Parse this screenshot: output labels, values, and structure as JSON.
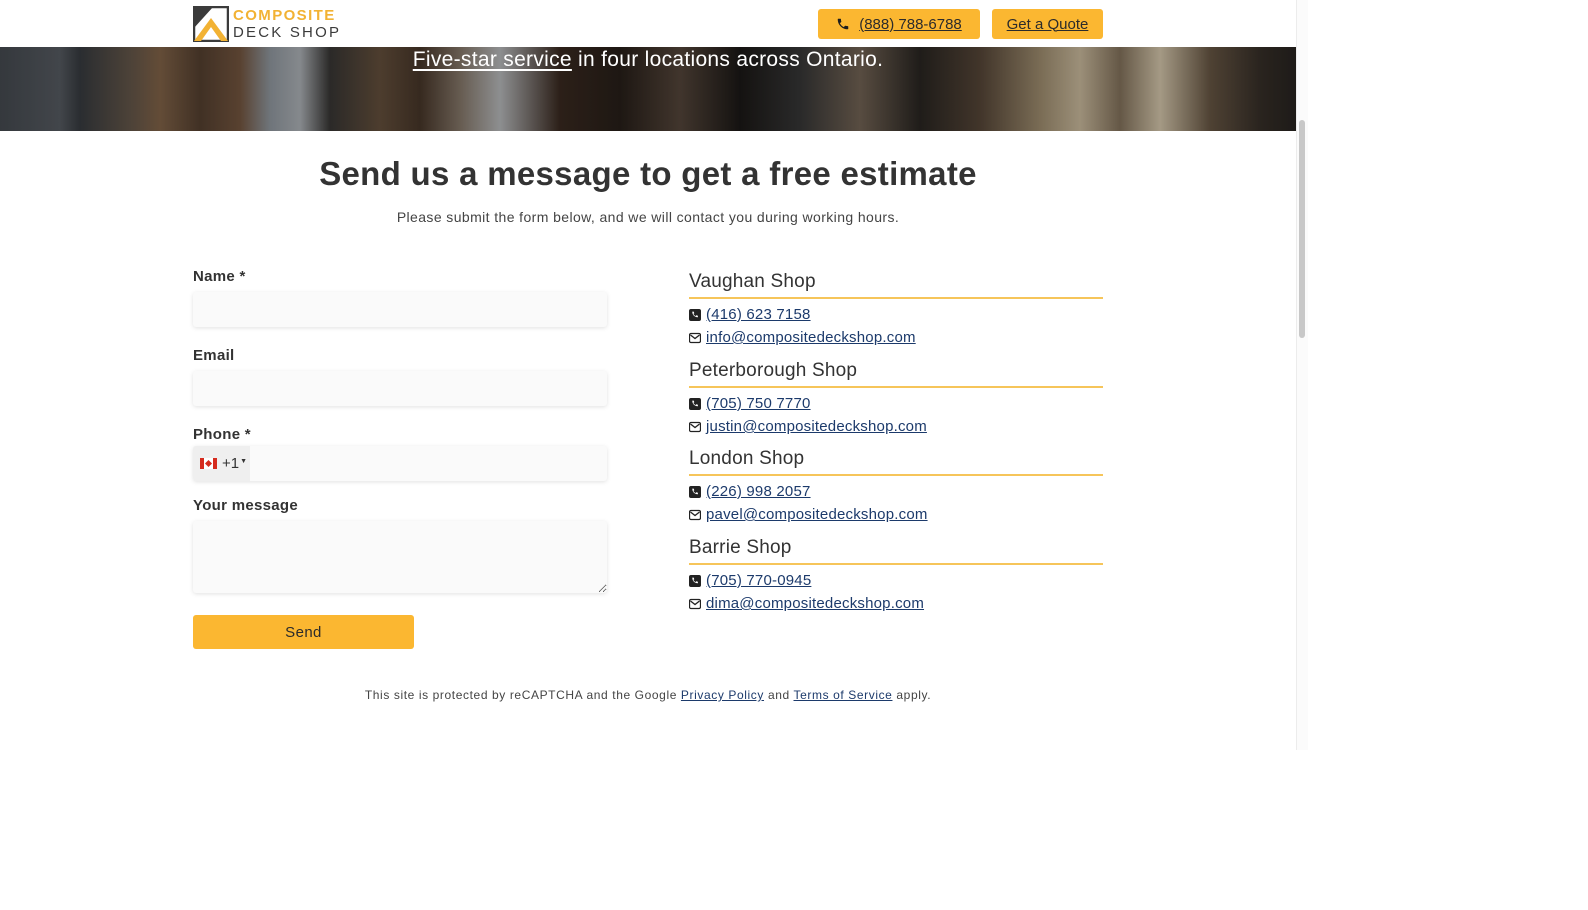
{
  "header": {
    "logo_line1": "COMPOSITE",
    "logo_line2": "DECK SHOP",
    "phone_button": "(888) 788-6788",
    "quote_button": "Get a Quote",
    "accent_color": "#fbb731"
  },
  "hero": {
    "link_text": "Five-star service",
    "rest_text": " in four locations across Ontario."
  },
  "main": {
    "title": "Send us a message to get a free estimate",
    "subtitle": "Please submit the form below, and we will contact you during working hours."
  },
  "form": {
    "name_label": "Name *",
    "email_label": "Email",
    "phone_label": "Phone *",
    "phone_country_code": "+1",
    "phone_flag": "canada-flag-icon",
    "message_label": "Your message",
    "send_label": "Send"
  },
  "shops": [
    {
      "name": "Vaughan Shop",
      "phone": "(416) 623 7158",
      "email": "info@compositedeckshop.com"
    },
    {
      "name": "Peterborough Shop",
      "phone": "(705) 750 7770",
      "email": "justin@compositedeckshop.com"
    },
    {
      "name": "London Shop",
      "phone": "(226) 998 2057",
      "email": "pavel@compositedeckshop.com"
    },
    {
      "name": "Barrie Shop",
      "phone": "(705) 770-0945",
      "email": "dima@compositedeckshop.com"
    }
  ],
  "footer": {
    "prefix": "This site is protected by reCAPTCHA and the Google ",
    "privacy": "Privacy Policy",
    "and": " and ",
    "terms": "Terms of Service",
    "suffix": " apply."
  }
}
